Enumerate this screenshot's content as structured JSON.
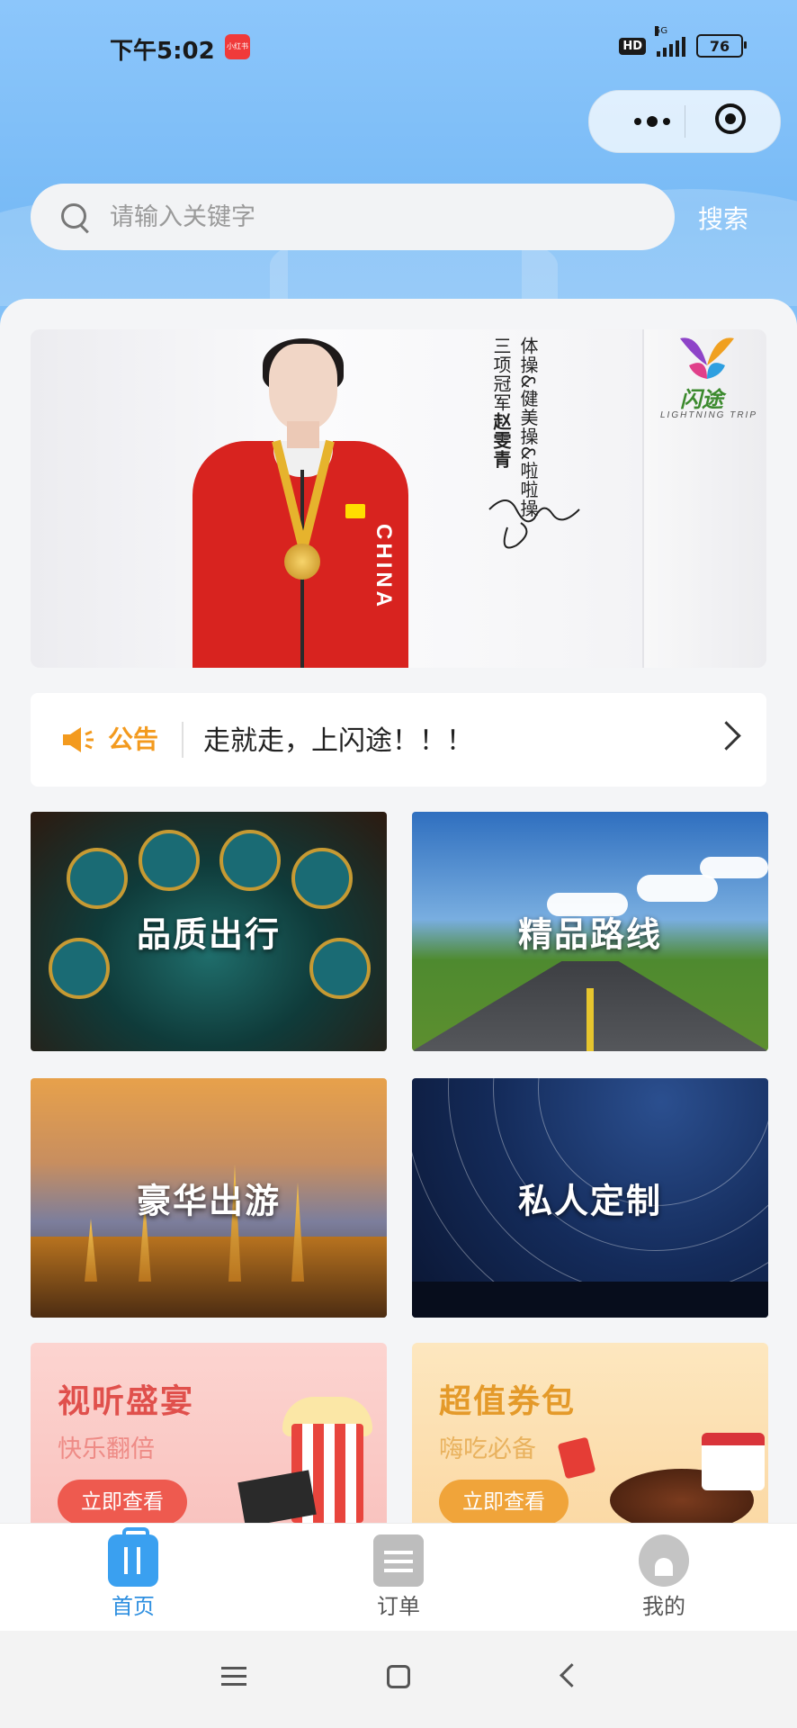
{
  "status_bar": {
    "time": "下午5:02",
    "app_badge": "小红书",
    "hd_label": "HD",
    "network": "5G",
    "battery": "76"
  },
  "search": {
    "placeholder": "请输入关键字",
    "button_label": "搜索"
  },
  "banner": {
    "col1_prefix": "三项冠军",
    "col1_name": "赵雯青",
    "col2": "体操&健美操&啦啦操",
    "logo_text": "闪途",
    "logo_sub": "LIGHTNING TRIP",
    "jacket_text": "CHINA"
  },
  "notice": {
    "label": "公告",
    "text": "走就走，上闪途！！！"
  },
  "tiles": [
    {
      "label": "品质出行"
    },
    {
      "label": "精品路线"
    },
    {
      "label": "豪华出游"
    },
    {
      "label": "私人定制"
    }
  ],
  "promos": [
    {
      "title": "视听盛宴",
      "subtitle": "快乐翻倍",
      "button": "立即查看"
    },
    {
      "title": "超值券包",
      "subtitle": "嗨吃必备",
      "button": "立即查看"
    }
  ],
  "tabbar": [
    {
      "label": "首页",
      "icon": "luggage-icon",
      "active": true
    },
    {
      "label": "订单",
      "icon": "order-icon",
      "active": false
    },
    {
      "label": "我的",
      "icon": "profile-icon",
      "active": false
    }
  ],
  "colors": {
    "header_blue": "#8cc6fb",
    "accent_blue": "#2e8fe0",
    "notice_orange": "#f39a1e"
  }
}
